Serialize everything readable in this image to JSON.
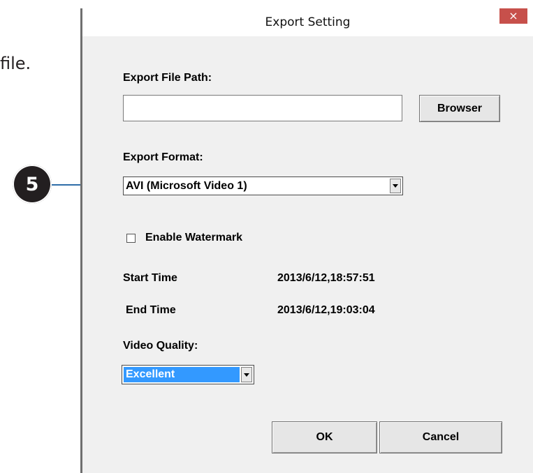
{
  "manual": {
    "text_fragment": "file.",
    "callout_number": "5"
  },
  "dialog": {
    "title": "Export Setting",
    "close_glyph": "×",
    "export_path": {
      "label": "Export File Path:",
      "value": "",
      "browse_label": "Browser"
    },
    "export_format": {
      "label": "Export Format:",
      "selected": "AVI (Microsoft Video 1)"
    },
    "watermark": {
      "label": "Enable Watermark",
      "checked": false
    },
    "start_time": {
      "label": "Start Time",
      "value": "2013/6/12,18:57:51"
    },
    "end_time": {
      "label": "End Time",
      "value": "2013/6/12,19:03:04"
    },
    "video_quality": {
      "label": "Video Quality:",
      "selected": "Excellent"
    },
    "ok_label": "OK",
    "cancel_label": "Cancel"
  },
  "colors": {
    "close_button": "#c7504b",
    "selection_highlight": "#3399ff",
    "callout_line": "#2e6da8"
  },
  "icons": {
    "close": "close-icon",
    "dropdown": "chevron-down-icon"
  }
}
